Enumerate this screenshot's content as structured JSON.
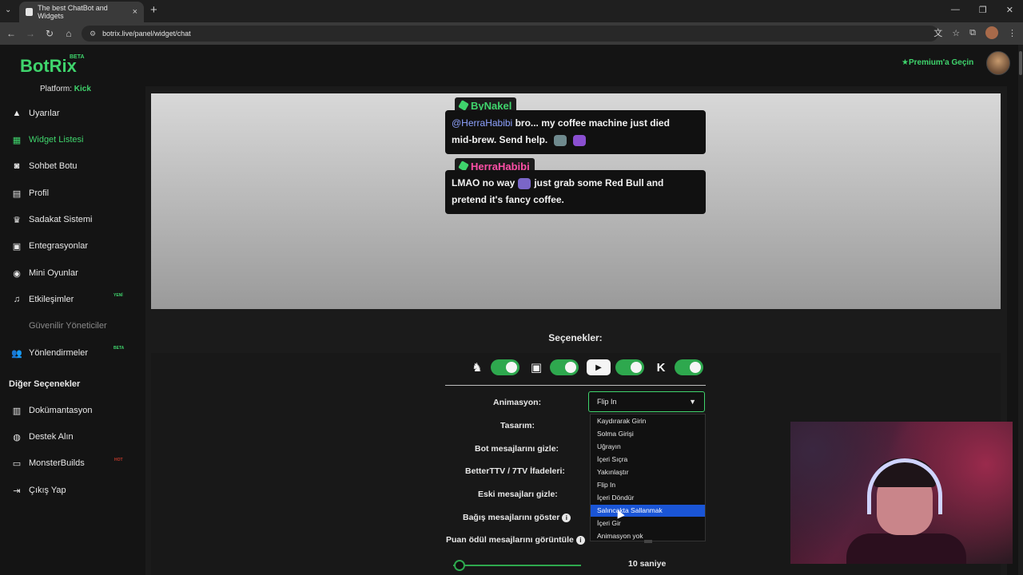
{
  "browser": {
    "tab_title": "The best ChatBot and Widgets",
    "url": "botrix.live/panel/widget/chat"
  },
  "header": {
    "logo": "BotRix",
    "beta": "BETA",
    "premium": "Premium'a Geçin"
  },
  "sidebar": {
    "platform_label": "Platform:",
    "platform_value": "Kick",
    "items": [
      {
        "label": "Uyarılar"
      },
      {
        "label": "Widget Listesi"
      },
      {
        "label": "Sohbet Botu"
      },
      {
        "label": "Profil"
      },
      {
        "label": "Sadakat Sistemi"
      },
      {
        "label": "Entegrasyonlar"
      },
      {
        "label": "Mini Oyunlar"
      },
      {
        "label": "Etkileşimler",
        "badge": "YENİ"
      },
      {
        "label": "Güvenilir Yöneticiler"
      },
      {
        "label": "Yönlendirmeler",
        "badge": "BETA"
      }
    ],
    "section_title": "Diğer Seçenekler",
    "other_items": [
      {
        "label": "Dokümantasyon"
      },
      {
        "label": "Destek Alın"
      },
      {
        "label": "MonsterBuilds",
        "badge": "HOT"
      },
      {
        "label": "Çıkış Yap"
      }
    ]
  },
  "preview": {
    "messages": [
      {
        "user": "ByNakel",
        "user_color": "#3fd46c",
        "mention": "@HerraHabibi",
        "line1_rest": "bro... my coffee machine just died",
        "line2": "mid-brew. Send help."
      },
      {
        "user": "HerraHabibi",
        "user_color": "#ff4fa7",
        "line1_before": "LMAO no way",
        "line1_after": "just grab some Red Bull and",
        "line2": "pretend it's fancy coffee."
      }
    ]
  },
  "options": {
    "title": "Seçenekler:",
    "labels": {
      "animation": "Animasyon:",
      "design": "Tasarım:",
      "hide_bot": "Bot mesajlarını gizle:",
      "bttv": "BetterTTV / 7TV İfadeleri:",
      "hide_old": "Eski mesajları gizle:",
      "donation": "Bağış mesajlarını göster",
      "points": "Puan ödül mesajlarını görüntüle"
    },
    "animation_selected": "Flip In",
    "animation_options": [
      "Kaydırarak Girin",
      "Solma Girişi",
      "Uğrayın",
      "İçeri Sıçra",
      "Yakınlaştır",
      "Flip In",
      "İçeri Döndür",
      "Salıncakta Sallanmak",
      "İçeri Gir",
      "Animasyon yok"
    ],
    "highlighted_option": "Salıncakta Sallanmak",
    "slider_value_label": "10 saniye",
    "slider_fraction": 0.05
  },
  "colors": {
    "accent": "#3fd46c",
    "selection": "#1a55d6"
  }
}
